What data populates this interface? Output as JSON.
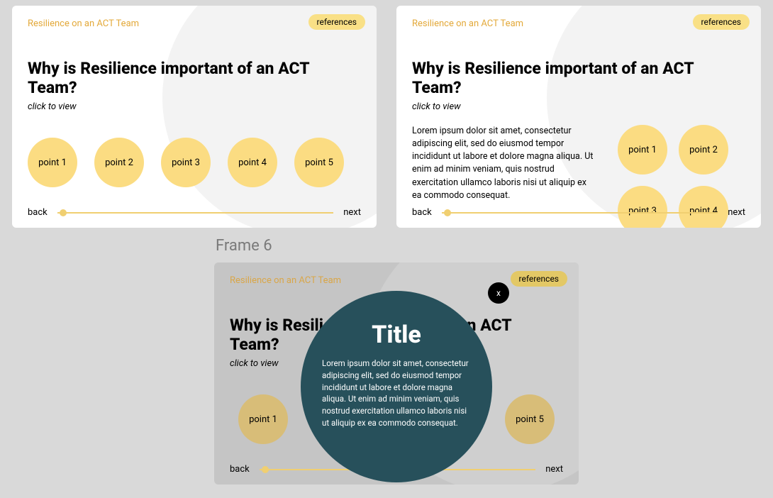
{
  "breadcrumb": "Resilience on an ACT Team",
  "references_label": "references",
  "heading": "Why is Resilience important of an ACT Team?",
  "subtitle": "click to view",
  "lorem": "Lorem ipsum dolor sit amet, consectetur adipiscing elit, sed do eiusmod tempor incididunt ut labore et dolore magna aliqua. Ut enim ad minim veniam, quis nostrud exercitation ullamco laboris nisi ut aliquip ex ea commodo consequat.",
  "nav": {
    "back": "back",
    "next": "next"
  },
  "frame_label": "Frame 6",
  "modal": {
    "title": "Title",
    "close": "x"
  },
  "card1": {
    "points": [
      "point 1",
      "point 2",
      "point 3",
      "point 4",
      "point 5"
    ]
  },
  "card2": {
    "points": [
      "point 1",
      "point 2",
      "point 3",
      "point 4"
    ]
  },
  "card3": {
    "points": [
      "point 1",
      "point 5"
    ]
  }
}
